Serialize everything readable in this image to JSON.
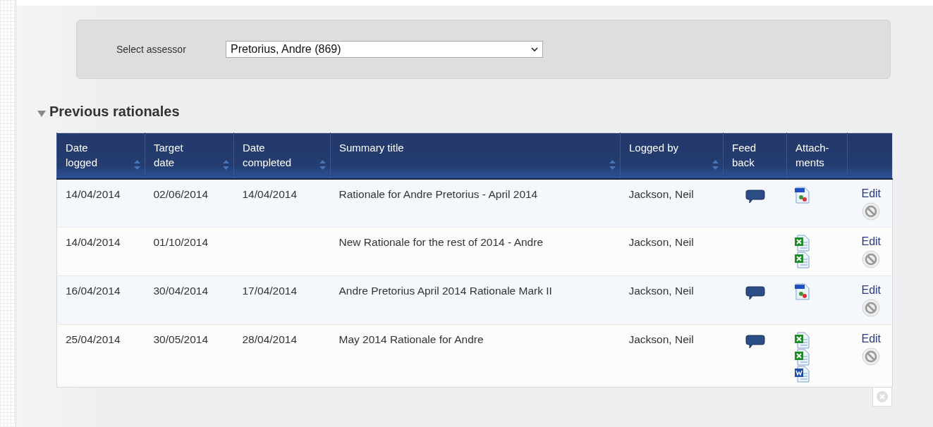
{
  "assessor_filter": {
    "label": "Select assessor",
    "value": "Pretorius, Andre (869)"
  },
  "section": {
    "title": "Previous rationales",
    "expanded": true
  },
  "table": {
    "columns": [
      {
        "label": "Date\nlogged",
        "sortable": true
      },
      {
        "label": "Target\ndate",
        "sortable": true
      },
      {
        "label": "Date\ncompleted",
        "sortable": true
      },
      {
        "label": "Summary title",
        "sortable": true
      },
      {
        "label": "Logged by",
        "sortable": true
      },
      {
        "label": "Feed\nback",
        "sortable": false
      },
      {
        "label": "Attach-\nments",
        "sortable": false
      },
      {
        "sortable": false
      }
    ],
    "rows": [
      {
        "date_logged": "14/04/2014",
        "target_date": "02/06/2014",
        "date_completed": "14/04/2014",
        "summary_title": "Rationale for Andre Pretorius - April 2014",
        "logged_by": "Jackson, Neil",
        "feedback": true,
        "attachments": [
          {
            "kind": "jpg"
          }
        ],
        "action": "Edit"
      },
      {
        "date_logged": "14/04/2014",
        "target_date": "01/10/2014",
        "date_completed": "",
        "summary_title": "New Rationale for the rest of 2014 - Andre",
        "logged_by": "Jackson, Neil",
        "feedback": false,
        "attachments": [
          {
            "kind": "excel"
          },
          {
            "kind": "excel"
          }
        ],
        "action": "Edit"
      },
      {
        "date_logged": "16/04/2014",
        "target_date": "30/04/2014",
        "date_completed": "17/04/2014",
        "summary_title": "Andre Pretorius April 2014 Rationale Mark II",
        "logged_by": "Jackson, Neil",
        "feedback": true,
        "attachments": [
          {
            "kind": "jpg"
          }
        ],
        "action": "Edit"
      },
      {
        "date_logged": "25/04/2014",
        "target_date": "30/05/2014",
        "date_completed": "28/04/2014",
        "summary_title": "May 2014 Rationale for Andre",
        "logged_by": "Jackson, Neil",
        "feedback": true,
        "attachments": [
          {
            "kind": "excel"
          },
          {
            "kind": "excel"
          },
          {
            "kind": "word"
          }
        ],
        "action": "Edit"
      }
    ]
  }
}
